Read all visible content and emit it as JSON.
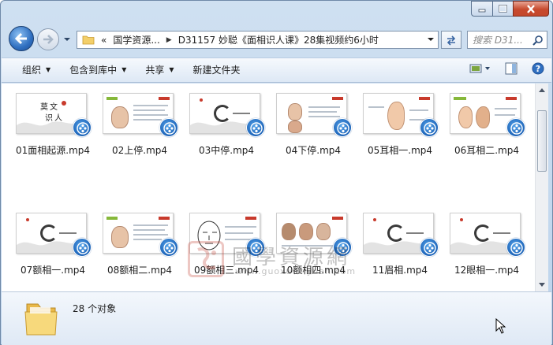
{
  "window": {
    "caption_buttons": [
      "minimize",
      "maximize",
      "close"
    ]
  },
  "nav": {
    "address_prefix": "«",
    "breadcrumb_parent": "国学资源...",
    "breadcrumb_current": "D31157 妙聪《面相识人课》28集视频约6小时",
    "search_placeholder": "搜索 D31..."
  },
  "toolbar": {
    "organize": "组织",
    "include_in_library": "包含到库中",
    "share": "共享",
    "new_folder": "新建文件夹"
  },
  "files": [
    {
      "name": "01面相起源.mp4",
      "style": "title"
    },
    {
      "name": "02上停.mp4",
      "style": "portrait"
    },
    {
      "name": "03中停.mp4",
      "style": "ink"
    },
    {
      "name": "04下停.mp4",
      "style": "faces"
    },
    {
      "name": "05耳相一.mp4",
      "style": "ear"
    },
    {
      "name": "06耳相二.mp4",
      "style": "ear2"
    },
    {
      "name": "07额相一.mp4",
      "style": "ink"
    },
    {
      "name": "08额相二.mp4",
      "style": "portrait"
    },
    {
      "name": "09额相三.mp4",
      "style": "sketch"
    },
    {
      "name": "10额相四.mp4",
      "style": "photos"
    },
    {
      "name": "11眉相.mp4",
      "style": "ink"
    },
    {
      "name": "12眼相一.mp4",
      "style": "ink"
    }
  ],
  "watermark": {
    "title": "國學資源網",
    "url": "www.guoxueziyuan.com"
  },
  "status": {
    "count_text": "28 个对象"
  },
  "colors": {
    "accent_blue": "#1c63b8",
    "close_red": "#c74a2e",
    "watermark_red": "#c23a2c"
  }
}
